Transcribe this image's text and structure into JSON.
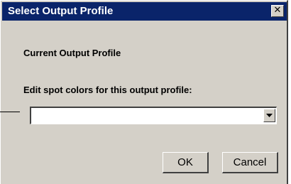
{
  "dialog": {
    "title": "Select Output Profile",
    "close_glyph": "✕",
    "current_profile_label": "Current Output Profile",
    "edit_spot_label": "Edit spot colors for this output profile:",
    "profile_select": {
      "value": "",
      "arrow_icon": "chevron-down-icon"
    },
    "ok_label": "OK",
    "cancel_label": "Cancel"
  },
  "colors": {
    "title_bar": "#0a246a",
    "face": "#d4d0c8"
  }
}
